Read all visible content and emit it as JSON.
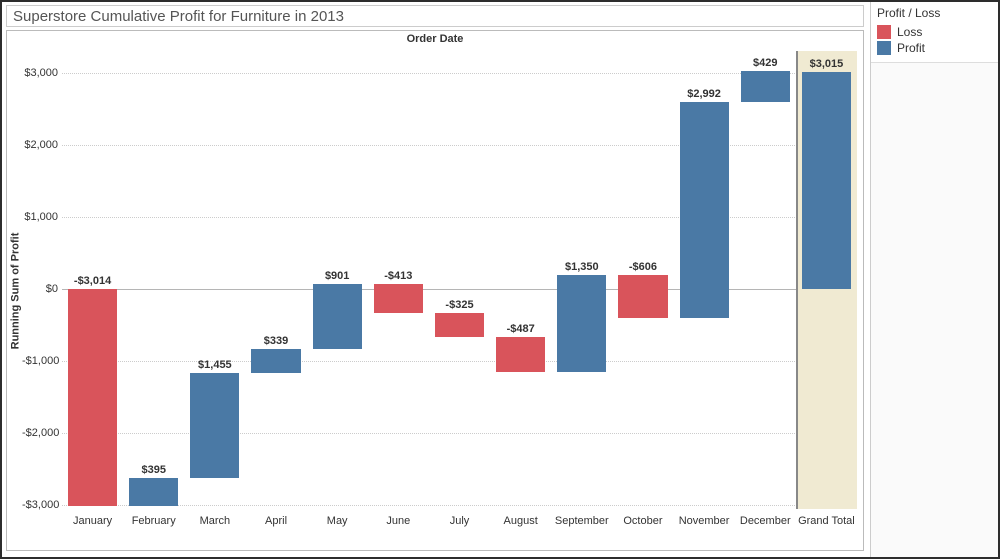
{
  "title": "Superstore Cumulative Profit for Furniture in 2013",
  "legend": {
    "title": "Profit / Loss",
    "items": [
      {
        "label": "Loss",
        "class": "loss"
      },
      {
        "label": "Profit",
        "class": "profit"
      }
    ]
  },
  "chart_data": {
    "type": "bar",
    "title": "Superstore Cumulative Profit for Furniture in 2013",
    "xlabel": "Order Date",
    "ylabel": "Running Sum of Profit",
    "ylim": [
      -3050,
      3300
    ],
    "yticks": [
      {
        "v": -3000,
        "label": "-$3,000"
      },
      {
        "v": -2000,
        "label": "-$2,000"
      },
      {
        "v": -1000,
        "label": "-$1,000"
      },
      {
        "v": 0,
        "label": "$0"
      },
      {
        "v": 1000,
        "label": "$1,000"
      },
      {
        "v": 2000,
        "label": "$2,000"
      },
      {
        "v": 3000,
        "label": "$3,000"
      }
    ],
    "categories": [
      "January",
      "February",
      "March",
      "April",
      "May",
      "June",
      "July",
      "August",
      "September",
      "October",
      "November",
      "December",
      "Grand Total"
    ],
    "bars": [
      {
        "label": "-$3,014",
        "type": "loss",
        "bottom": -3014,
        "top": 0
      },
      {
        "label": "$395",
        "type": "profit",
        "bottom": -3014,
        "top": -2619
      },
      {
        "label": "$1,455",
        "type": "profit",
        "bottom": -2619,
        "top": -1164
      },
      {
        "label": "$339",
        "type": "profit",
        "bottom": -1164,
        "top": -825
      },
      {
        "label": "$901",
        "type": "profit",
        "bottom": -825,
        "top": 76
      },
      {
        "label": "-$413",
        "type": "loss",
        "bottom": -337,
        "top": 76
      },
      {
        "label": "-$325",
        "type": "loss",
        "bottom": -662,
        "top": -337
      },
      {
        "label": "-$487",
        "type": "loss",
        "bottom": -1149,
        "top": -662
      },
      {
        "label": "$1,350",
        "type": "profit",
        "bottom": -1149,
        "top": 201
      },
      {
        "label": "-$606",
        "type": "loss",
        "bottom": -405,
        "top": 201
      },
      {
        "label": "$2,992",
        "type": "profit",
        "bottom": -405,
        "top": 2587
      },
      {
        "label": "$429",
        "type": "profit",
        "bottom": 2587,
        "top": 3016
      },
      {
        "label": "$3,015",
        "type": "grand",
        "bottom": 0,
        "top": 3015
      }
    ]
  }
}
